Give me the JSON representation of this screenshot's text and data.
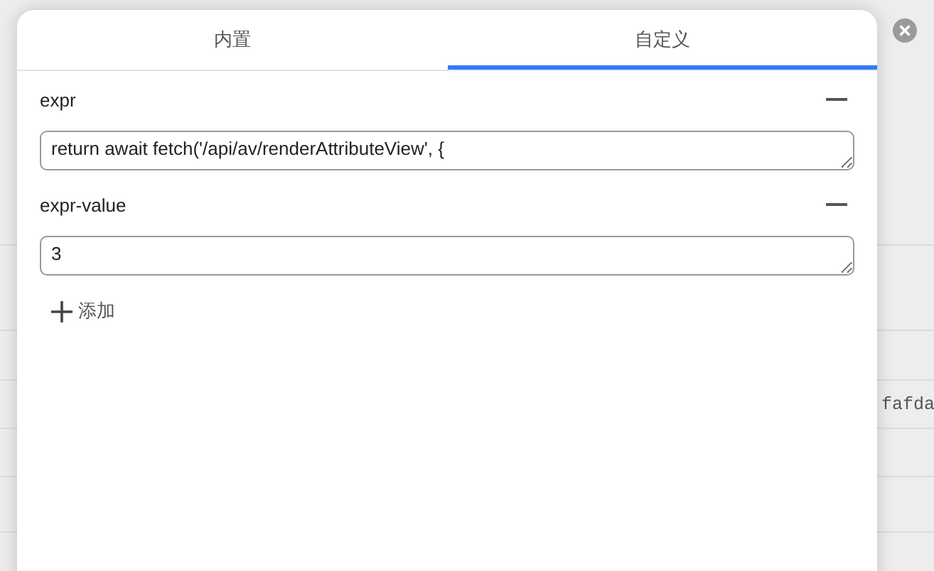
{
  "tabs": [
    {
      "label": "内置",
      "selected": false
    },
    {
      "label": "自定义",
      "selected": true
    }
  ],
  "fields": [
    {
      "label": "expr",
      "value": "return await fetch('/api/av/renderAttributeView', {"
    },
    {
      "label": "expr-value",
      "value": "3"
    }
  ],
  "add_button": {
    "label": "添加"
  },
  "background_table": {
    "cell_text": "fafda"
  }
}
